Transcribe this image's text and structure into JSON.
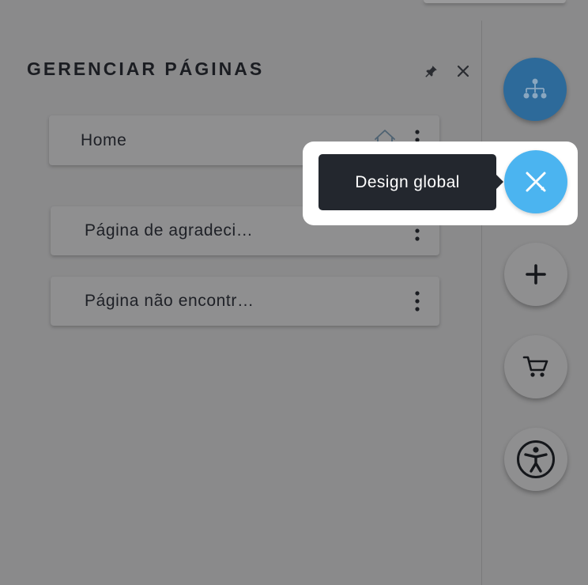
{
  "panel": {
    "title": "GERENCIAR PÁGINAS",
    "pin_icon": "pin-icon",
    "close_icon": "close-icon"
  },
  "pages": [
    {
      "label": "Home",
      "is_home": true
    },
    {
      "label": "Página de agradeci…",
      "is_home": false
    },
    {
      "label": "Página não encontr…",
      "is_home": false
    }
  ],
  "rail": {
    "sitemap_icon": "sitemap-icon",
    "design_icon": "design-tools-icon",
    "add_icon": "plus-icon",
    "cart_icon": "cart-icon",
    "accessibility_icon": "accessibility-icon"
  },
  "tooltip": {
    "text": "Design global"
  },
  "colors": {
    "overlay": "#8a8a8b",
    "sitemap_button": "#2d6a9a",
    "design_button": "#4bb4f0",
    "tooltip_bg": "#23272e",
    "title_text": "#1b1d22"
  }
}
